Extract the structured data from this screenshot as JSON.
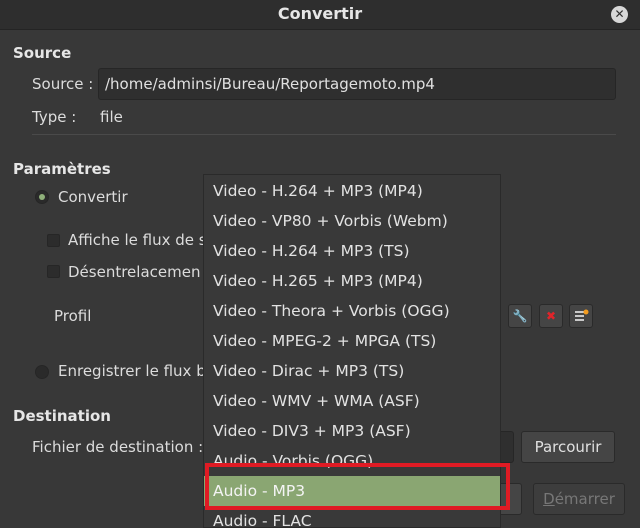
{
  "window": {
    "title": "Convertir"
  },
  "source": {
    "section_title": "Source",
    "source_label": "Source :",
    "source_value": "/home/adminsi/Bureau/Reportagemoto.mp4",
    "type_label": "Type :",
    "type_value": "file"
  },
  "params": {
    "section_title": "Paramètres",
    "convert_label": "Convertir",
    "display_stream_label": "Affiche le flux de s",
    "deinterlace_label": "Désentrelacemen",
    "profile_label": "Profil",
    "record_stream_label": "Enregistrer le flux b"
  },
  "destination": {
    "section_title": "Destination",
    "file_label": "Fichier de destination :",
    "browse_label": "Parcourir"
  },
  "footer": {
    "start_label": "Démarrer",
    "start_mnemonic": "D",
    "start_rest": "émarrer"
  },
  "profile_dropdown": {
    "items": [
      "Video - H.264 + MP3 (MP4)",
      "Video - VP80 + Vorbis (Webm)",
      "Video - H.264 + MP3 (TS)",
      "Video - H.265 + MP3 (MP4)",
      "Video - Theora + Vorbis (OGG)",
      "Video - MPEG-2 + MPGA (TS)",
      "Video - Dirac + MP3 (TS)",
      "Video - WMV + WMA (ASF)",
      "Video - DIV3 + MP3 (ASF)",
      "Audio - Vorbis (OGG)",
      "Audio - MP3",
      "Audio - FLAC"
    ],
    "selected_index": 10
  },
  "colors": {
    "selected_bg": "#8aa672",
    "highlight_border": "#e01b24"
  }
}
